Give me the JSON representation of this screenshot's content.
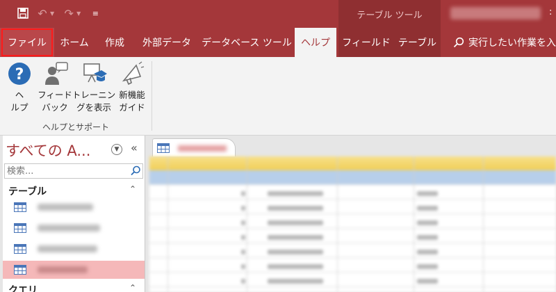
{
  "qat": {
    "save_icon": "save-icon",
    "undo_icon": "undo-icon",
    "redo_icon": "redo-icon",
    "customize_icon": "customize-qat-icon"
  },
  "title_bar": {
    "context_header": "テーブル ツール",
    "overflow": ":"
  },
  "tabs": {
    "file": "ファイル",
    "home": "ホーム",
    "create": "作成",
    "external_data": "外部データ",
    "database_tools": "データベース ツール",
    "help": "ヘルプ",
    "fields": "フィールド",
    "table": "テーブル",
    "tell_me": "実行したい作業を入"
  },
  "ribbon": {
    "group_label": "ヘルプとサポート",
    "buttons": [
      {
        "label": "ヘ\nルプ",
        "icon": "help-icon"
      },
      {
        "label": "フィード\nバック",
        "icon": "feedback-icon"
      },
      {
        "label": "トレーニン\nグを表示",
        "icon": "training-icon"
      },
      {
        "label": "新機能\nガイド",
        "icon": "whats-new-icon"
      }
    ]
  },
  "nav_pane": {
    "title": "すべての A...",
    "search_placeholder": "検索...",
    "sections": {
      "tables": "テーブル",
      "queries": "クエリ"
    }
  },
  "colors": {
    "accent": "#a4373a",
    "selected_item": "#f5b8b9",
    "header_row": "#f1cf57",
    "current_row": "#b7cfea"
  }
}
